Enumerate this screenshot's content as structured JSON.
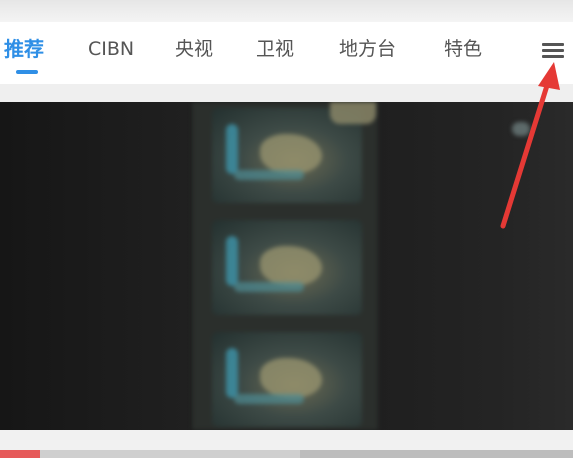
{
  "tabs": [
    {
      "label": "推荐",
      "active": true
    },
    {
      "label": "CIBN",
      "active": false
    },
    {
      "label": "央视",
      "active": false
    },
    {
      "label": "卫视",
      "active": false
    },
    {
      "label": "地方台",
      "active": false
    },
    {
      "label": "特色",
      "active": false
    }
  ],
  "menu": {
    "icon": "hamburger-menu-icon"
  },
  "colors": {
    "accent": "#2f8fe6",
    "tab_text": "#555555",
    "annotation_arrow": "#e53935",
    "video_background": "#1d1d1d"
  }
}
